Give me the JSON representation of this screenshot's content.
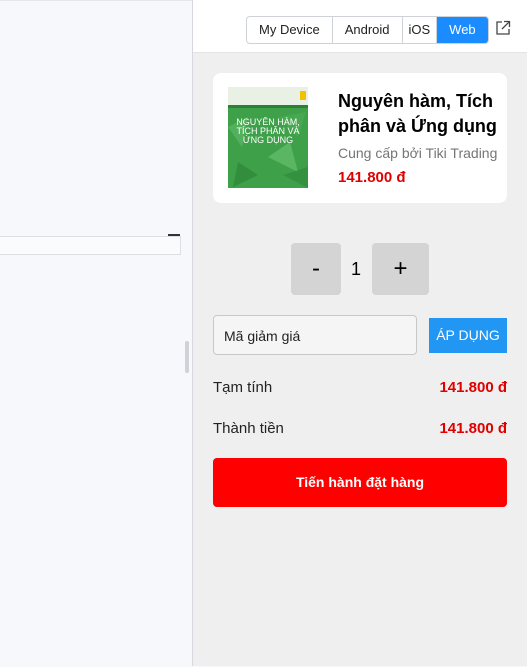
{
  "device_tabs": [
    "My Device",
    "Android",
    "iOS",
    "Web"
  ],
  "active_tab": "Web",
  "product": {
    "name": "Nguyên hàm, Tích phân và Ứng dụng",
    "seller": "Cung cấp bởi Tiki Trading",
    "price": "141.800 đ",
    "cover_title": "NGUYÊN HÀM, TÍCH PHÂN VÀ ỨNG DỤNG"
  },
  "quantity": {
    "minus_label": "-",
    "value": "1",
    "plus_label": "+"
  },
  "coupon": {
    "placeholder": "Mã giảm giá",
    "apply_label": "ÁP DỤNG"
  },
  "summary": {
    "subtotal_label": "Tạm tính",
    "subtotal_value": "141.800 đ",
    "total_label": "Thành tiền",
    "total_value": "141.800 đ"
  },
  "checkout_label": "Tiến hành đặt hàng",
  "colors": {
    "accent_blue": "#1a8cff",
    "price_red": "#e00000",
    "checkout_red": "#ff0000",
    "apply_blue": "#2196f3"
  },
  "icons": {
    "popout": "external-link-icon"
  }
}
